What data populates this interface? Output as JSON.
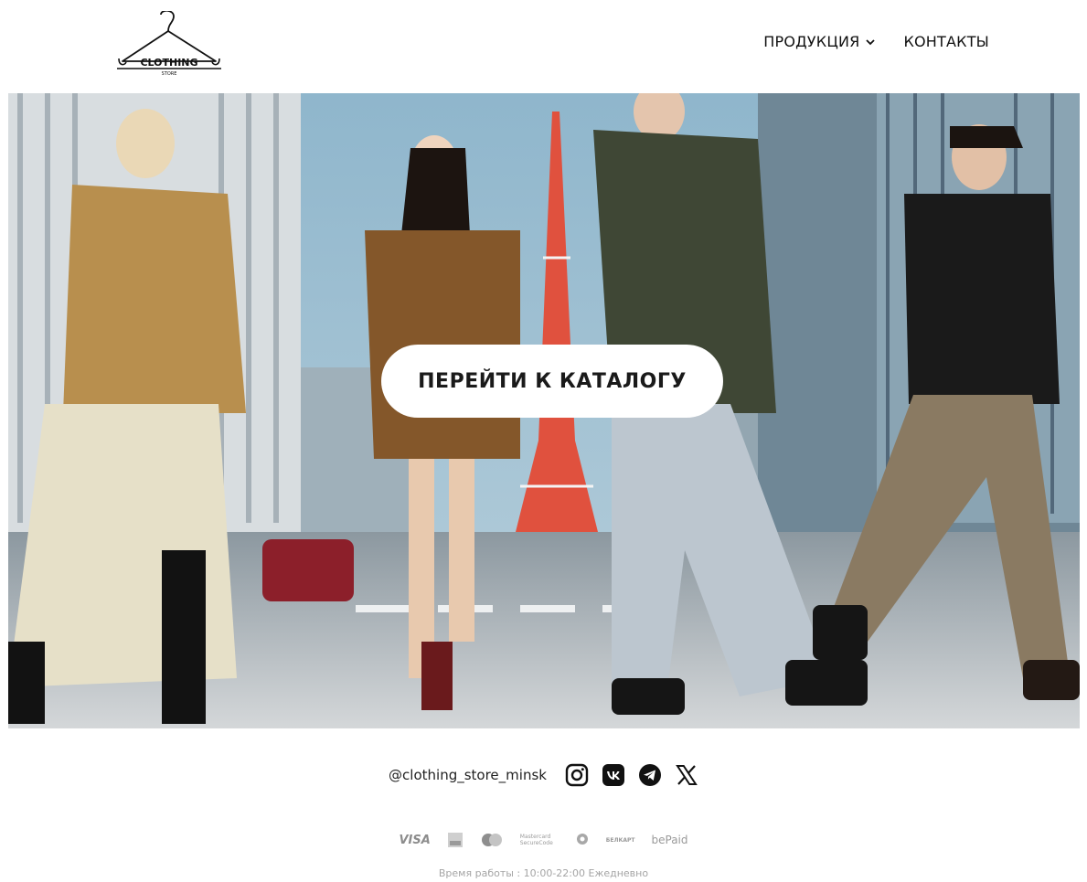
{
  "header": {
    "logo_text": "CLOTHING",
    "logo_subtext": "STORE",
    "nav": [
      {
        "label": "ПРОДУКЦИЯ",
        "has_dropdown": true,
        "icon": "chevron-down-icon"
      },
      {
        "label": "КОНТАКТЫ",
        "has_dropdown": false
      }
    ]
  },
  "hero": {
    "cta_label": "ПЕРЕЙТИ К КАТАЛОГУ"
  },
  "footer": {
    "social_handle": "@clothing_store_minsk",
    "social_icons": [
      "instagram-icon",
      "vk-icon",
      "telegram-icon",
      "x-icon"
    ],
    "payments": {
      "visa": "VISA",
      "mastercard": "Mastercard SecureCode",
      "belkart": "БЕЛКАРТ",
      "bepaid": "bePaid"
    },
    "hours": "Время работы : 10:00-22:00 Ежедневно"
  },
  "colors": {
    "text": "#111111",
    "cta_bg": "#ffffff",
    "muted": "#a5a5a5"
  }
}
